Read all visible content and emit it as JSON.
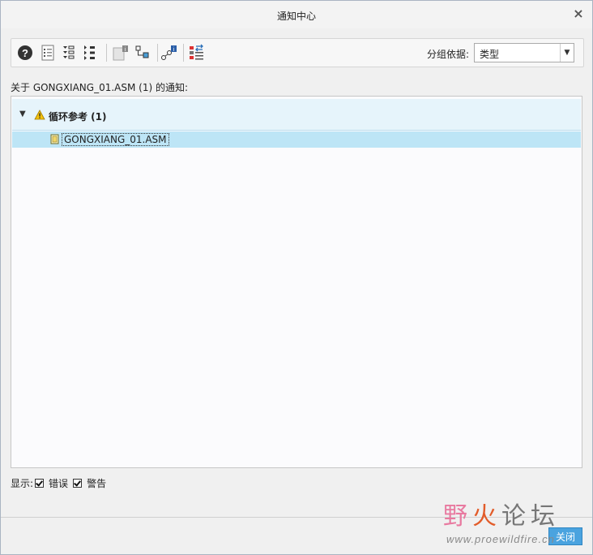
{
  "window": {
    "title": "通知中心",
    "close_symbol": "×"
  },
  "toolbar": {
    "buttons": [
      "help-icon",
      "list-details-icon",
      "expand-all-icon",
      "collapse-all-icon",
      "notification-info-icon",
      "tree-link-icon",
      "link-info-icon",
      "sort-list-icon"
    ],
    "group_by_label": "分组依据:",
    "group_by_value": "类型"
  },
  "notice_label": "关于 GONGXIANG_01.ASM (1) 的通知:",
  "tree": {
    "groups": [
      {
        "label": "循环参考 (1)",
        "icon": "warning-icon",
        "expanded": true,
        "items": [
          {
            "label": "GONGXIANG_01.ASM",
            "icon": "assembly-icon",
            "selected": true
          }
        ]
      }
    ]
  },
  "footer": {
    "show_label": "显示:",
    "errors_label": "错误",
    "errors_checked": true,
    "warnings_label": "警告",
    "warnings_checked": true
  },
  "close_button": "关闭",
  "watermark": {
    "chars": [
      "野",
      "火",
      "论坛"
    ],
    "sub": "www.proewildfire.cn"
  }
}
